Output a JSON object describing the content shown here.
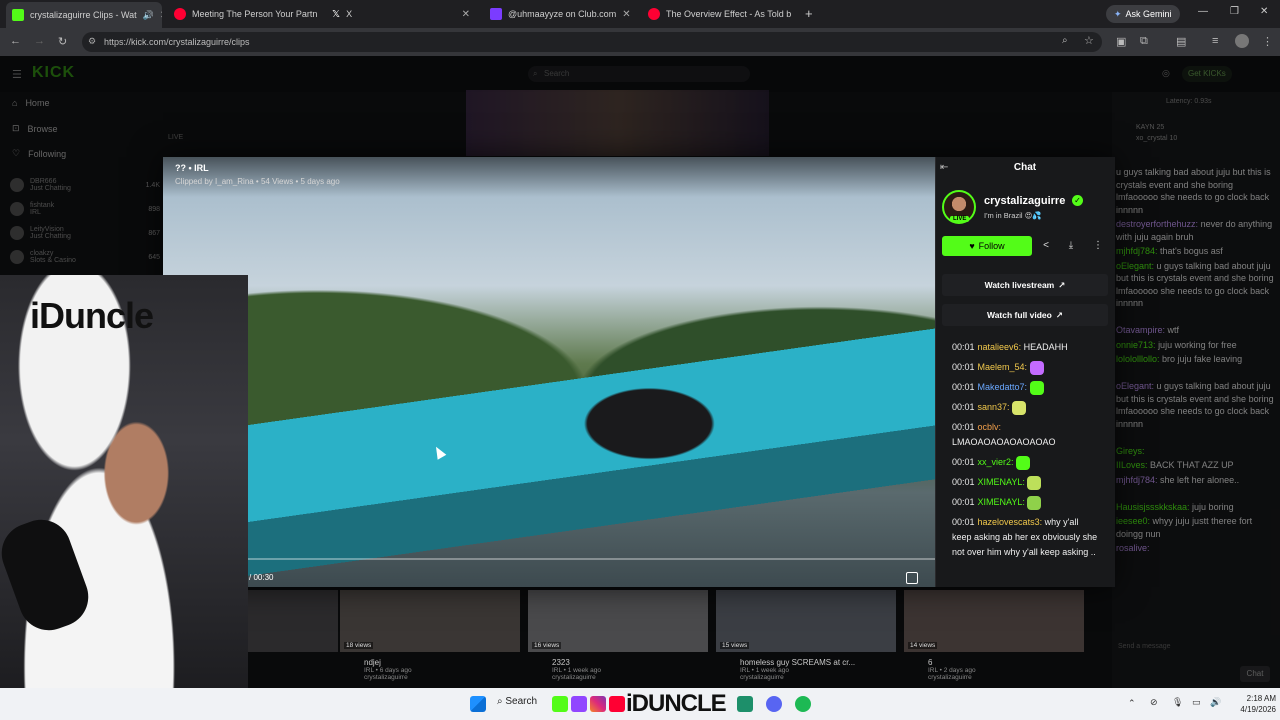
{
  "browser": {
    "tabs": [
      {
        "title": "crystalizaguirre Clips - Wat",
        "color": "#53fc18"
      },
      {
        "title": "Meeting The Person Your Partn",
        "color": "#ff0033"
      },
      {
        "title": "X",
        "color": "#ffffff"
      },
      {
        "title": "@uhmaayyze on Club.com",
        "color": "#7b3cff"
      },
      {
        "title": "The Overview Effect - As Told b",
        "color": "#ff0033"
      }
    ],
    "gemini_label": "Ask Gemini",
    "url": "https://kick.com/crystalizaguirre/clips"
  },
  "kick": {
    "search_placeholder": "Search",
    "get_kicks": "Get KICKs",
    "latency": "Latency: 0.93s",
    "live_label": "LIVE",
    "nav": {
      "home": "Home",
      "browse": "Browse",
      "following": "Following"
    },
    "following": [
      {
        "name": "DBR666",
        "sub": "Just Chatting",
        "count": "1.4K"
      },
      {
        "name": "fishtank",
        "sub": "IRL",
        "count": "898"
      },
      {
        "name": "LeityVision",
        "sub": "Just Chatting",
        "count": "867"
      },
      {
        "name": "cloakzy",
        "sub": "Slots & Casino",
        "count": "645"
      }
    ],
    "leaderboard": [
      {
        "name": "KAYN",
        "count": "25"
      },
      {
        "name": "xo_crystal",
        "count": "10"
      }
    ],
    "send_placeholder": "Send a message",
    "chat_button": "Chat"
  },
  "bg_chat": [
    {
      "user": "",
      "text": "u guys talking bad about juju but this is crystals event and she boring lmfaooooo she needs to go clock back innnnn"
    },
    {
      "user": "destroyerforthehuzz:",
      "text": "never do anything with juju again bruh"
    },
    {
      "user": "mjhfdj784:",
      "text": "that's bogus asf"
    },
    {
      "user": "oElegant:",
      "text": "u guys talking bad about juju but this is crystals event and she boring lmfaooooo she needs to go clock back innnnn"
    },
    {
      "user": "Otavampire:",
      "text": "wtf"
    },
    {
      "user": "onnie713:",
      "text": "juju working for free"
    },
    {
      "user": "lolololllollo:",
      "text": "bro juju fake leaving"
    },
    {
      "user": "oElegant:",
      "text": "u guys talking bad about juju but this is crystals event and she boring lmfaooooo she needs to go clock back innnnn"
    },
    {
      "user": "Gireys:",
      "text": ""
    },
    {
      "user": "IILoves:",
      "text": "BACK THAT AZZ UP"
    },
    {
      "user": "mjhfdj784:",
      "text": "she left her alonee.."
    },
    {
      "user": "Hausisjssskkskaa:",
      "text": "juju boring"
    },
    {
      "user": "ieesee0:",
      "text": "whyy juju justt theree fort doingg nun"
    },
    {
      "user": "rosalive:",
      "text": ""
    }
  ],
  "clip": {
    "title": "?? • IRL",
    "subtitle": "Clipped by I_am_Rina • 54 Views • 5 days ago",
    "timecode": "/ 00:30"
  },
  "chat_panel": {
    "title": "Chat",
    "streamer": "crystalizaguirre",
    "bio": "I'm in Brazil 😍💦",
    "live_badge": "LIVE",
    "follow": "Follow",
    "watch_livestream": "Watch livestream",
    "watch_full_video": "Watch full video",
    "messages": [
      {
        "time": "00:01",
        "user": "natalieev6:",
        "color": "#f2c94c",
        "text": "HEADAHH",
        "emote": ""
      },
      {
        "time": "00:01",
        "user": "Maelem_54:",
        "color": "#f2c94c",
        "text": "",
        "emote": "#c36bff"
      },
      {
        "time": "00:01",
        "user": "Makedatto7:",
        "color": "#6aa8ff",
        "text": "",
        "emote": "#53fc18"
      },
      {
        "time": "00:01",
        "user": "sann37:",
        "color": "#f2c94c",
        "text": "",
        "emote": "#d7e36a"
      },
      {
        "time": "00:01",
        "user": "ocblv:",
        "color": "#f2a04c",
        "text": "LMAOAOAOAOAOAOAO",
        "emote": ""
      },
      {
        "time": "00:01",
        "user": "xx_vier2:",
        "color": "#53fc18",
        "text": "",
        "emote": "#53fc18"
      },
      {
        "time": "00:01",
        "user": "XIMENAYL:",
        "color": "#53fc18",
        "text": "",
        "emote": "#bde05a"
      },
      {
        "time": "00:01",
        "user": "XIMENAYL:",
        "color": "#53fc18",
        "text": "",
        "emote": "#8fd14a"
      },
      {
        "time": "00:01",
        "user": "hazelovescats3:",
        "color": "#f2c94c",
        "text": "why y'all keep asking ab her ex obviously she not over him why y'all keep asking ..",
        "emote": ""
      }
    ]
  },
  "clip_cards": [
    {
      "views": "",
      "title": "",
      "sub": ""
    },
    {
      "views": "18 views",
      "title": "ndjej",
      "sub": "IRL • 6 days ago"
    },
    {
      "views": "16 views",
      "title": "2323",
      "sub": "IRL • 1 week ago"
    },
    {
      "views": "15 views",
      "title": "homeless guy SCREAMS at cr...",
      "sub": "IRL • 1 week ago"
    },
    {
      "views": "14 views",
      "title": "6",
      "sub": "IRL • 2 days ago"
    }
  ],
  "card_channel": "crystalizaguirre",
  "webcam": {
    "label": "iDuncle"
  },
  "taskbar": {
    "search": "Search",
    "brand": "iDUNCLE",
    "time": "2:18 AM",
    "date": "4/19/2026"
  }
}
